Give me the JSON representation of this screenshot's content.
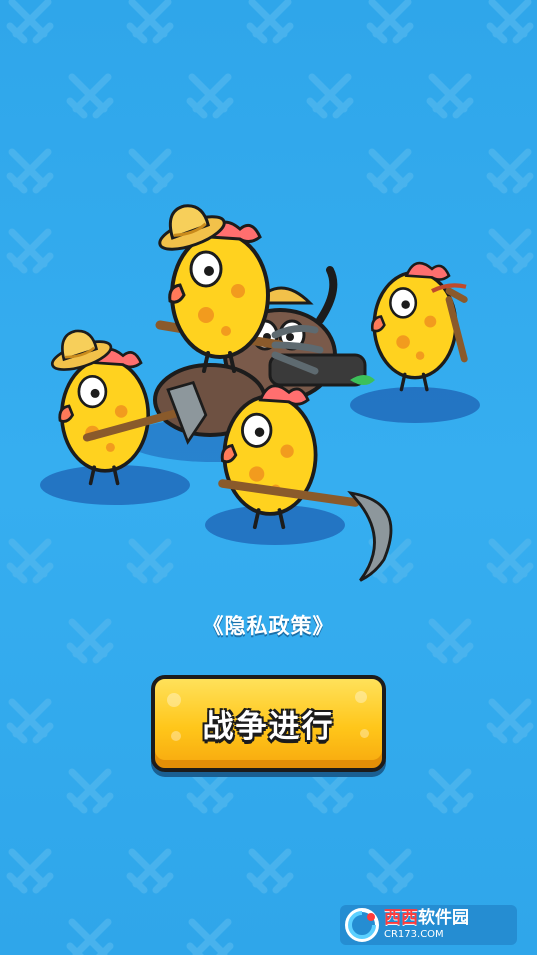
{
  "screen": {
    "background_color": "#2fa6ea"
  },
  "privacy_link": {
    "label": "《隐私政策》"
  },
  "start_button": {
    "label": "战争进行",
    "color": "#ffc61a"
  },
  "watermark": {
    "name_red": "西西",
    "name_white": "软件园",
    "domain": "CR173.COM"
  }
}
